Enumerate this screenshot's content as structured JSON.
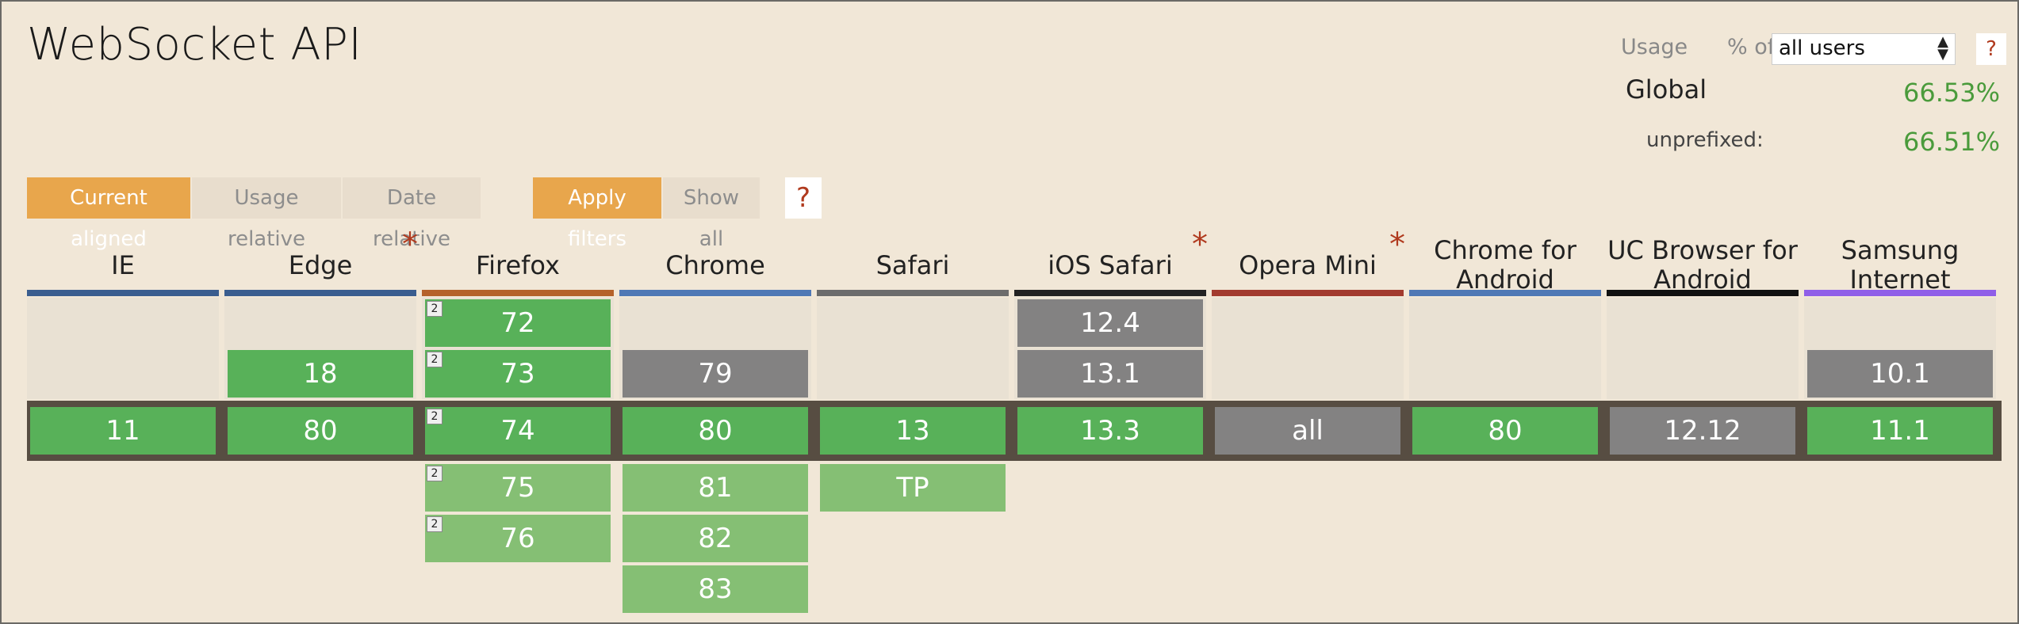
{
  "title": "WebSocket API",
  "usage": {
    "label": "Usage",
    "percent_of": "% of",
    "select_value": "all users",
    "help": "?",
    "global_label": "Global",
    "global_pct": "66.53%",
    "unprefixed_label": "unprefixed:",
    "unprefixed_pct": "66.51%"
  },
  "controls": {
    "current_aligned": "Current aligned",
    "usage_relative": "Usage relative",
    "date_relative": "Date relative",
    "apply_filters": "Apply filters",
    "show_all": "Show all",
    "help": "?"
  },
  "star_symbol": "*",
  "note_symbol": "2",
  "browsers": [
    {
      "name": "IE",
      "bar_color": "#3a5d8f",
      "star": false
    },
    {
      "name": "Edge",
      "bar_color": "#3a5d8f",
      "star": true
    },
    {
      "name": "Firefox",
      "bar_color": "#b5622a",
      "star": false
    },
    {
      "name": "Chrome",
      "bar_color": "#4f78b5",
      "star": false
    },
    {
      "name": "Safari",
      "bar_color": "#6c6c6c",
      "star": false
    },
    {
      "name": "iOS Safari",
      "bar_color": "#222222",
      "star": true
    },
    {
      "name": "Opera Mini",
      "bar_color": "#a23a2e",
      "star": true
    },
    {
      "name": "Chrome for Android",
      "bar_color": "#4f78b5",
      "star": false
    },
    {
      "name": "UC Browser for Android",
      "bar_color": "#111111",
      "star": false
    },
    {
      "name": "Samsung Internet",
      "bar_color": "#8f5ee8",
      "star": false
    }
  ],
  "cells": [
    {
      "col": 2,
      "row": 0,
      "value": "72",
      "status": "supported",
      "note": true
    },
    {
      "col": 5,
      "row": 0,
      "value": "12.4",
      "status": "unknown",
      "note": false
    },
    {
      "col": 1,
      "row": 1,
      "value": "18",
      "status": "supported",
      "note": false
    },
    {
      "col": 2,
      "row": 1,
      "value": "73",
      "status": "supported",
      "note": true
    },
    {
      "col": 3,
      "row": 1,
      "value": "79",
      "status": "unknown",
      "note": false
    },
    {
      "col": 5,
      "row": 1,
      "value": "13.1",
      "status": "unknown",
      "note": false
    },
    {
      "col": 9,
      "row": 1,
      "value": "10.1",
      "status": "unknown",
      "note": false
    },
    {
      "col": 0,
      "row": 2,
      "value": "11",
      "status": "supported",
      "note": false
    },
    {
      "col": 1,
      "row": 2,
      "value": "80",
      "status": "supported",
      "note": false
    },
    {
      "col": 2,
      "row": 2,
      "value": "74",
      "status": "supported",
      "note": true
    },
    {
      "col": 3,
      "row": 2,
      "value": "80",
      "status": "supported",
      "note": false
    },
    {
      "col": 4,
      "row": 2,
      "value": "13",
      "status": "supported",
      "note": false
    },
    {
      "col": 5,
      "row": 2,
      "value": "13.3",
      "status": "supported",
      "note": false
    },
    {
      "col": 6,
      "row": 2,
      "value": "all",
      "status": "unknown",
      "note": false
    },
    {
      "col": 7,
      "row": 2,
      "value": "80",
      "status": "supported",
      "note": false
    },
    {
      "col": 8,
      "row": 2,
      "value": "12.12",
      "status": "unknown",
      "note": false
    },
    {
      "col": 9,
      "row": 2,
      "value": "11.1",
      "status": "supported",
      "note": false
    },
    {
      "col": 2,
      "row": 3,
      "value": "75",
      "status": "future",
      "note": true
    },
    {
      "col": 3,
      "row": 3,
      "value": "81",
      "status": "future",
      "note": false
    },
    {
      "col": 4,
      "row": 3,
      "value": "TP",
      "status": "future",
      "note": false
    },
    {
      "col": 2,
      "row": 4,
      "value": "76",
      "status": "future",
      "note": true
    },
    {
      "col": 3,
      "row": 4,
      "value": "82",
      "status": "future",
      "note": false
    },
    {
      "col": 3,
      "row": 5,
      "value": "83",
      "status": "future",
      "note": false
    }
  ]
}
